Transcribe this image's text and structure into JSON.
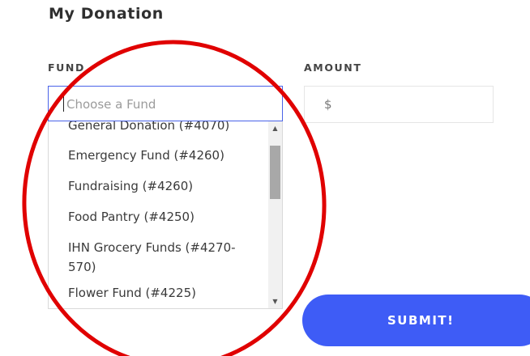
{
  "form": {
    "heading": "My Donation",
    "fund_label": "FUND",
    "amount_label": "AMOUNT",
    "fund_placeholder": "Choose a Fund",
    "currency_symbol": "$",
    "submit_label": "SUBMIT!"
  },
  "fund_options": [
    "General Donation (#4070)",
    "Emergency Fund (#4260)",
    "Fundraising (#4260)",
    "Food Pantry (#4250)",
    "IHN Grocery Funds (#4270-570)",
    "Flower Fund (#4225)"
  ],
  "colors": {
    "accent": "#3e5cf6",
    "annotation_circle": "#e00000"
  },
  "icons": {
    "scroll_up": "▲",
    "scroll_down": "▼"
  }
}
